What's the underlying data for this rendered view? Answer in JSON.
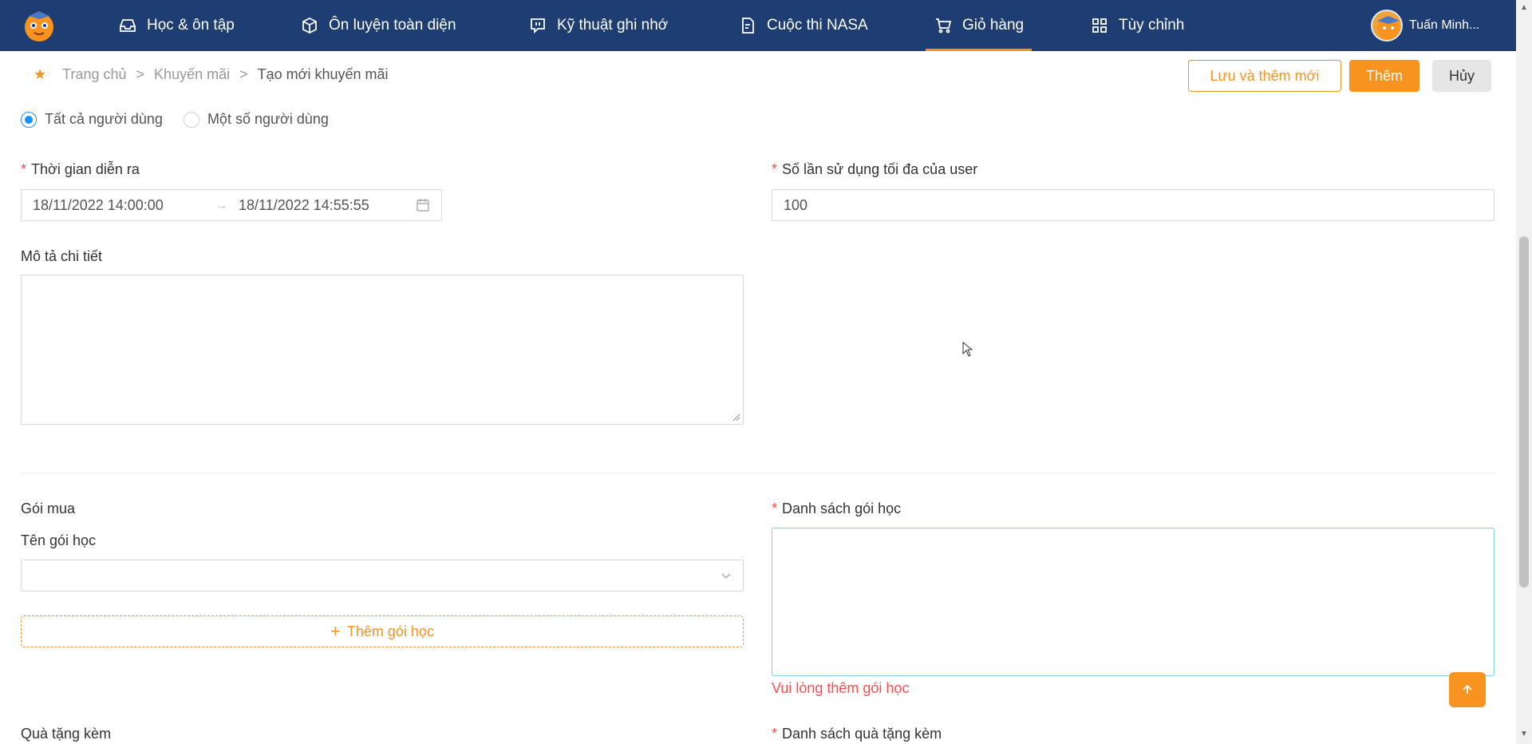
{
  "nav": {
    "items": [
      {
        "label": "Học & ôn tập",
        "icon": "inbox-icon"
      },
      {
        "label": "Ôn luyện toàn diện",
        "icon": "cube-icon"
      },
      {
        "label": "Kỹ thuật ghi nhớ",
        "icon": "chat-icon"
      },
      {
        "label": "Cuộc thi NASA",
        "icon": "document-icon"
      },
      {
        "label": "Giỏ hàng",
        "icon": "cart-icon",
        "active": true
      },
      {
        "label": "Tùy chỉnh",
        "icon": "grid-icon"
      }
    ],
    "user_name": "Tuấn Minh...",
    "active_color": "#f7931e",
    "bg_color": "#1e3d73"
  },
  "breadcrumb": {
    "home": "Trang chủ",
    "sep": ">",
    "section": "Khuyến mãi",
    "current": "Tạo mới khuyến mãi"
  },
  "actions": {
    "save_and_new": "Lưu và thêm mới",
    "add": "Thêm",
    "cancel": "Hủy"
  },
  "audience": {
    "options": [
      "Tất cả người dùng",
      "Một số người dùng"
    ],
    "selected": "Tất cả người dùng"
  },
  "form": {
    "time_label": "Thời gian diễn ra",
    "start_date": "18/11/2022 14:00:00",
    "end_date": "18/11/2022 14:55:55",
    "max_usage_label": "Số lần sử dụng tối đa của user",
    "max_usage_value": "100",
    "description_label": "Mô tả chi tiết",
    "description_value": "",
    "package_section_label": "Gói mua",
    "package_name_label": "Tên gói học",
    "package_name_value": "",
    "add_package_button": "Thêm gói học",
    "package_list_label": "Danh sách gói học",
    "package_list_error": "Vui lòng thêm gói học",
    "gift_section_label": "Quà tặng kèm",
    "gift_list_label": "Danh sách quà tặng kèm"
  }
}
